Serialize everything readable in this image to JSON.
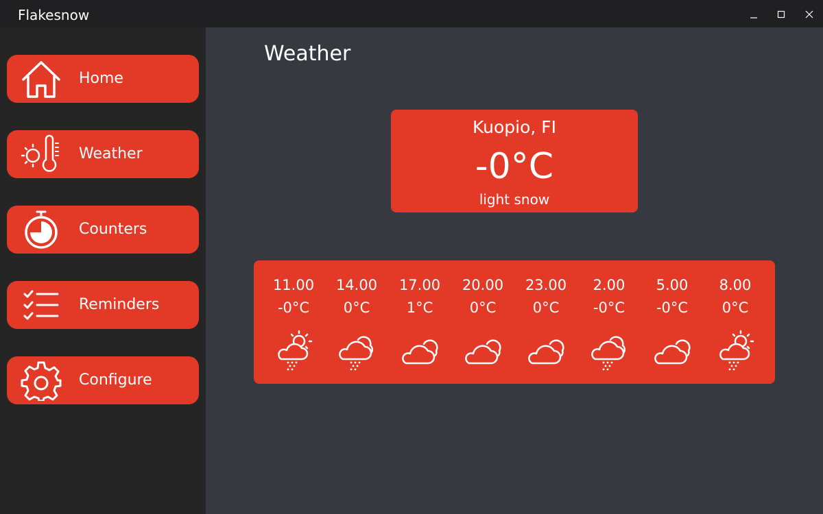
{
  "window": {
    "title": "Flakesnow"
  },
  "sidebar": {
    "items": [
      {
        "label": "Home",
        "icon": "home-icon"
      },
      {
        "label": "Weather",
        "icon": "thermometer-sun-icon"
      },
      {
        "label": "Counters",
        "icon": "stopwatch-icon"
      },
      {
        "label": "Reminders",
        "icon": "checklist-icon"
      },
      {
        "label": "Configure",
        "icon": "gear-icon"
      }
    ]
  },
  "main": {
    "title": "Weather",
    "current": {
      "location": "Kuopio, FI",
      "temperature": "-0°C",
      "condition": "light snow"
    },
    "forecast": [
      {
        "time": "11.00",
        "temp": "-0°C",
        "icon": "sun-cloud-snow-icon"
      },
      {
        "time": "14.00",
        "temp": "0°C",
        "icon": "cloud-snow-icon"
      },
      {
        "time": "17.00",
        "temp": "1°C",
        "icon": "cloud-icon"
      },
      {
        "time": "20.00",
        "temp": "0°C",
        "icon": "cloud-icon"
      },
      {
        "time": "23.00",
        "temp": "0°C",
        "icon": "cloud-icon"
      },
      {
        "time": "2.00",
        "temp": "-0°C",
        "icon": "cloud-snow-icon"
      },
      {
        "time": "5.00",
        "temp": "-0°C",
        "icon": "cloud-icon"
      },
      {
        "time": "8.00",
        "temp": "0°C",
        "icon": "sun-cloud-snow-icon"
      }
    ]
  },
  "colors": {
    "accent": "#e33a28",
    "background": "#373941",
    "sidebar": "#252526",
    "titlebar": "#202022"
  }
}
